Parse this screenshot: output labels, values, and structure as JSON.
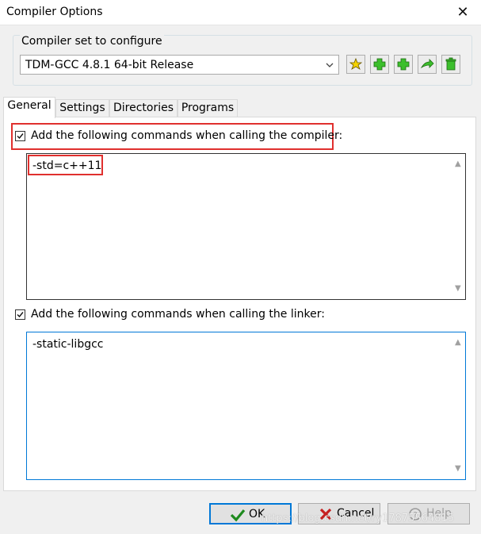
{
  "window": {
    "title": "Compiler Options"
  },
  "compiler_set": {
    "group_label": "Compiler set to configure",
    "selected": "TDM-GCC 4.8.1 64-bit Release"
  },
  "toolbar_icons": [
    "find-compiler-icon",
    "add-icon",
    "add-icon",
    "rename-icon",
    "delete-icon"
  ],
  "tabs": [
    {
      "label": "General",
      "active": true
    },
    {
      "label": "Settings",
      "active": false
    },
    {
      "label": "Directories",
      "active": false
    },
    {
      "label": "Programs",
      "active": false
    }
  ],
  "general": {
    "compiler_checkbox_label": "Add the following commands when calling the compiler:",
    "compiler_checked": true,
    "compiler_commands": "-std=c++11",
    "linker_checkbox_label": "Add the following commands when calling the linker:",
    "linker_checked": true,
    "linker_commands": "-static-libgcc"
  },
  "buttons": {
    "ok": "OK",
    "cancel": "Cancel",
    "help": "Help"
  },
  "watermark": "https://blog.csdn.net/ry17875564815",
  "colors": {
    "highlight_box": "#e0302e",
    "focus_border": "#0078d7"
  }
}
